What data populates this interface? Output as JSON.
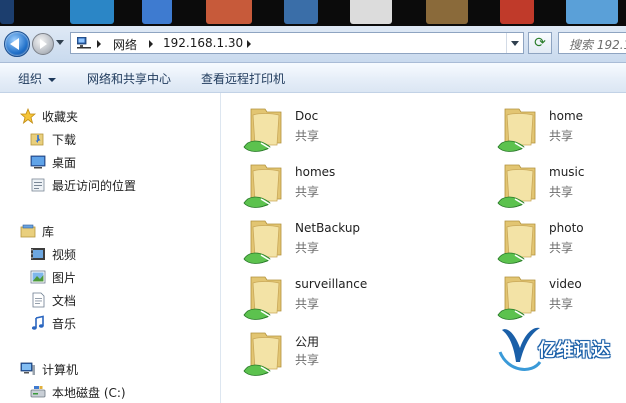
{
  "taskbar": {
    "thumbnail_colors": [
      "#1c3e6e",
      "#2b86c6",
      "#c75a3a",
      "#3e7bd0",
      "#dcdcdc",
      "#8a6a3a",
      "#3a6ea8",
      "#c03a2a",
      "#5aa0d8",
      "#e8e8e8"
    ]
  },
  "address_bar": {
    "segments": [
      "网络",
      "192.168.1.30"
    ],
    "search_placeholder": "搜索 192.1..."
  },
  "toolbar": {
    "organize_label": "组织",
    "network_center_label": "网络和共享中心",
    "printers_label": "查看远程打印机"
  },
  "navigation": {
    "favorites": {
      "label": "收藏夹",
      "items": [
        {
          "label": "下载",
          "icon": "downloads-folder-icon"
        },
        {
          "label": "桌面",
          "icon": "desktop-icon"
        },
        {
          "label": "最近访问的位置",
          "icon": "recent-places-icon"
        }
      ]
    },
    "libraries": {
      "label": "库",
      "items": [
        {
          "label": "视频",
          "icon": "videos-library-icon"
        },
        {
          "label": "图片",
          "icon": "pictures-library-icon"
        },
        {
          "label": "文档",
          "icon": "documents-library-icon"
        },
        {
          "label": "音乐",
          "icon": "music-library-icon"
        }
      ]
    },
    "computer": {
      "label": "计算机",
      "items": [
        {
          "label": "本地磁盘 (C:)",
          "icon": "local-disk-icon"
        }
      ]
    }
  },
  "shares": [
    {
      "name": "Doc",
      "type": "共享"
    },
    {
      "name": "home",
      "type": "共享"
    },
    {
      "name": "homes",
      "type": "共享"
    },
    {
      "name": "music",
      "type": "共享"
    },
    {
      "name": "NetBackup",
      "type": "共享"
    },
    {
      "name": "photo",
      "type": "共享"
    },
    {
      "name": "surveillance",
      "type": "共享"
    },
    {
      "name": "video",
      "type": "共享"
    },
    {
      "name": "公用",
      "type": "共享"
    }
  ],
  "watermark": {
    "text": "亿维讯达",
    "color": "#1a5fa8"
  }
}
